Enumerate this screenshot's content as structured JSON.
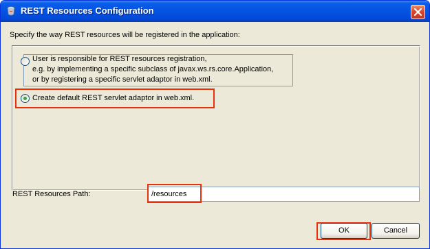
{
  "window": {
    "title": "REST Resources Configuration"
  },
  "dialog": {
    "instruction": "Specify the way REST resources will be registered in the application:",
    "options": [
      {
        "line1": "User is responsible for REST resources registration,",
        "line2": "e.g. by implementing a specific subclass of javax.ws.rs.core.Application,",
        "line3": "or by registering a specific servlet adaptor in web.xml.",
        "selected": false
      },
      {
        "label": "Create default REST servlet adaptor in web.xml.",
        "selected": true
      }
    ],
    "path_label": "REST Resources Path:",
    "path_value": "/resources"
  },
  "buttons": {
    "ok": "OK",
    "cancel": "Cancel"
  },
  "colors": {
    "highlight": "#e8310c",
    "titlebar": "#0554e3",
    "dialog_bg": "#ece9d8"
  },
  "icons": {
    "title": "java-cup-icon",
    "close": "close-icon"
  }
}
